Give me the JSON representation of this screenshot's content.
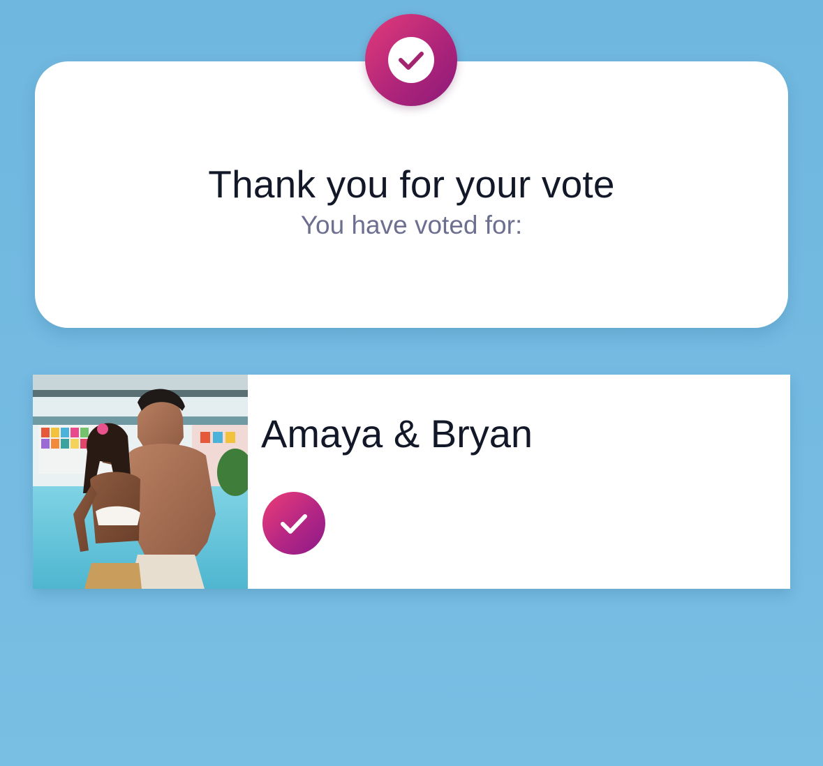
{
  "confirmation": {
    "title": "Thank you for your vote",
    "subtitle": "You have voted for:",
    "badge_icon": "check-circle-icon"
  },
  "candidate": {
    "name": "Amaya & Bryan",
    "photo_icon": "couple-photo",
    "selected": true,
    "selected_icon": "check-icon"
  },
  "colors": {
    "background": "#72b8df",
    "card": "#ffffff",
    "accent_start": "#e33b79",
    "accent_end": "#8b1a78",
    "title_text": "#121827",
    "subtitle_text": "#6c6f8f"
  }
}
